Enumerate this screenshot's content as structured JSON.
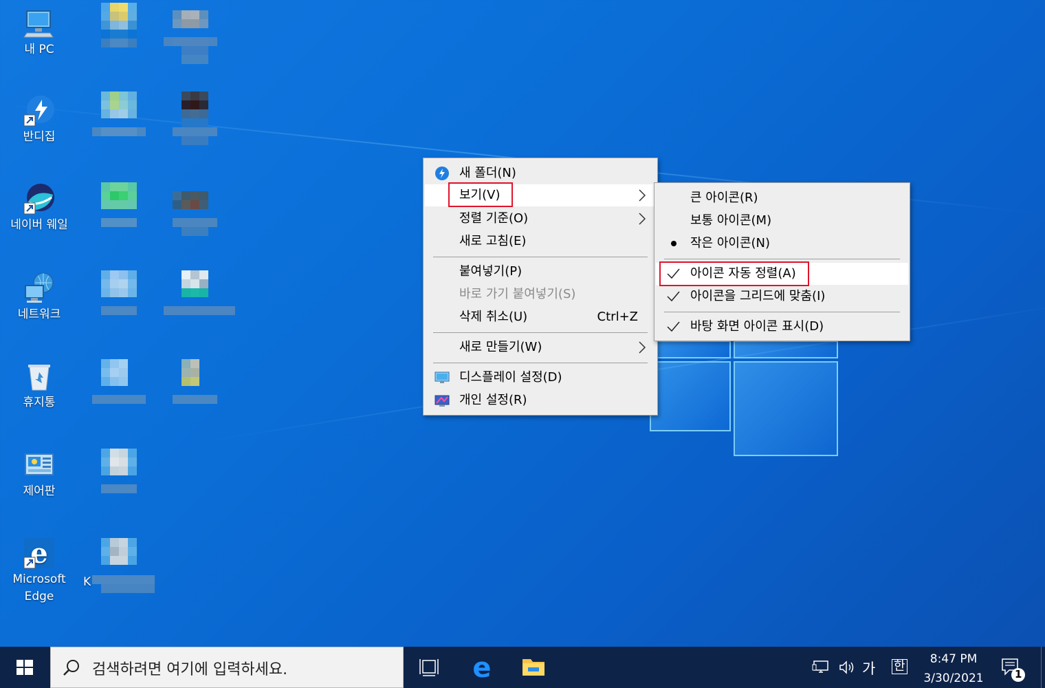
{
  "desktop": {
    "icons": [
      {
        "label": "내 PC",
        "icon": "computer-icon"
      },
      {
        "label": "반디집",
        "icon": "bandizip-icon"
      },
      {
        "label": "네이버 웨일",
        "icon": "whale-browser-icon"
      },
      {
        "label": "네트워크",
        "icon": "network-icon"
      },
      {
        "label": "휴지통",
        "icon": "recycle-bin-icon"
      },
      {
        "label": "제어판",
        "icon": "control-panel-icon"
      },
      {
        "label": "Microsoft Edge",
        "icon": "edge-icon"
      }
    ],
    "partial_label": "K"
  },
  "context_menu": {
    "items": [
      {
        "label": "새 폴더(N)",
        "icon": "bandizip-icon",
        "submenu": false
      },
      {
        "label": "보기(V)",
        "submenu": true,
        "highlighted": true
      },
      {
        "label": "정렬 기준(O)",
        "submenu": true
      },
      {
        "label": "새로 고침(E)",
        "submenu": false
      },
      {
        "label": "붙여넣기(P)",
        "submenu": false
      },
      {
        "label": "바로 가기 붙여넣기(S)",
        "submenu": false,
        "disabled": true
      },
      {
        "label": "삭제 취소(U)",
        "shortcut": "Ctrl+Z"
      },
      {
        "label": "새로 만들기(W)",
        "submenu": true
      },
      {
        "label": "디스플레이 설정(D)",
        "icon": "display-icon"
      },
      {
        "label": "개인 설정(R)",
        "icon": "personalize-icon"
      }
    ]
  },
  "view_submenu": {
    "items": [
      {
        "label": "큰 아이콘(R)",
        "state": "none"
      },
      {
        "label": "보통 아이콘(M)",
        "state": "none"
      },
      {
        "label": "작은 아이콘(N)",
        "state": "bullet"
      },
      {
        "label": "아이콘 자동 정렬(A)",
        "state": "check",
        "highlighted": true
      },
      {
        "label": "아이콘을 그리드에 맞춤(I)",
        "state": "check"
      },
      {
        "label": "바탕 화면 아이콘 표시(D)",
        "state": "check"
      }
    ]
  },
  "taskbar": {
    "search_placeholder": "검색하려면 여기에 입력하세요.",
    "ime_mode": "가",
    "ime_lang": "한",
    "time": "8:47 PM",
    "date": "3/30/2021",
    "notification_count": "1"
  },
  "colors": {
    "highlight_box": "#e0142c",
    "taskbar": "#0e2348",
    "menu_bg": "#eeeeee"
  }
}
